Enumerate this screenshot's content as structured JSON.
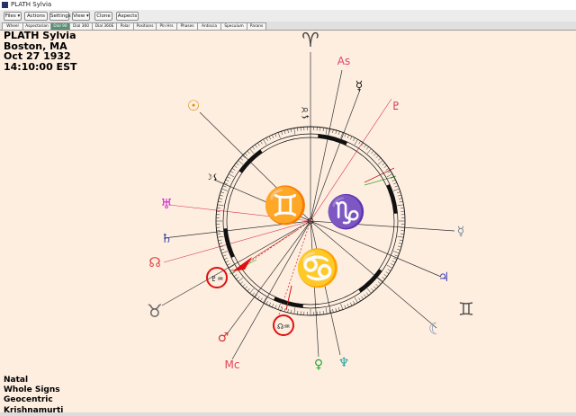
{
  "window": {
    "title": "PLATH Sylvia"
  },
  "menu": [
    {
      "label": "Files ▾"
    },
    {
      "label": "Actions ▾"
    },
    {
      "label": "Settings"
    },
    {
      "label": "View ▾"
    },
    {
      "label": "Clone"
    },
    {
      "label": "Aspects ▾"
    }
  ],
  "tabs": [
    {
      "label": "Wheel"
    },
    {
      "label": "Aspectarian"
    },
    {
      "label": "Dial 90"
    },
    {
      "label": "Dial 360"
    },
    {
      "label": "Dial 360E"
    },
    {
      "label": "Polar"
    },
    {
      "label": "Positions"
    },
    {
      "label": "Pln Hrs"
    },
    {
      "label": "Phases"
    },
    {
      "label": "Antiscia"
    },
    {
      "label": "Speculum"
    },
    {
      "label": "Parans"
    }
  ],
  "active_tab": "Dial 90",
  "chart_info": {
    "name": "PLATH Sylvia",
    "place": "Boston, MA",
    "date": "Oct 27 1932",
    "time": "14:10:00  EST"
  },
  "chart_settings": {
    "type": "Natal",
    "house_system": "Whole Signs",
    "center": "Geocentric",
    "ayanamsa": "Krishnamurti"
  },
  "dial": {
    "ring_labels": {
      "top": "♈",
      "inner_left": "♊",
      "inner_right": "♑",
      "inner_bottom": "♋"
    },
    "bodies": [
      {
        "name": "Aries point",
        "glyph": "♈",
        "color": "#444444"
      },
      {
        "name": "Ascendant",
        "glyph": "As",
        "color": "#e0446e"
      },
      {
        "name": "Mercury",
        "glyph": "☿",
        "color": "#111111"
      },
      {
        "name": "Pluto",
        "glyph": "♇",
        "color": "#cc1133"
      },
      {
        "name": "Sun",
        "glyph": "☉",
        "color": "#e08a00"
      },
      {
        "name": "Moon",
        "glyph": "☽",
        "color": "#444444"
      },
      {
        "name": "Uranus",
        "glyph": "♅",
        "color": "#cc22cc"
      },
      {
        "name": "Saturn",
        "glyph": "♄",
        "color": "#3344aa"
      },
      {
        "name": "North Node",
        "glyph": "☊",
        "color": "#e04444"
      },
      {
        "name": "Taurus",
        "glyph": "♉",
        "color": "#666666"
      },
      {
        "name": "Mars",
        "glyph": "♂",
        "color": "#d33333"
      },
      {
        "name": "Midheaven",
        "glyph": "Mc",
        "color": "#e04455"
      },
      {
        "name": "Venus",
        "glyph": "♀",
        "color": "#22aa33"
      },
      {
        "name": "Neptune",
        "glyph": "♆",
        "color": "#22a0a0"
      },
      {
        "name": "Gemini",
        "glyph": "♊",
        "color": "#555555"
      },
      {
        "name": "Jupiter",
        "glyph": "♃",
        "color": "#4444bb"
      },
      {
        "name": "Moon phase",
        "glyph": "☾",
        "color": "#8899bb"
      },
      {
        "name": "Mercury2",
        "glyph": "☿",
        "color": "#778899"
      }
    ],
    "small_labels": {
      "top_label": "⚸♉",
      "left_label": "☽⚸",
      "circled_1": "♇♒",
      "circled_2": "☊♒"
    }
  }
}
